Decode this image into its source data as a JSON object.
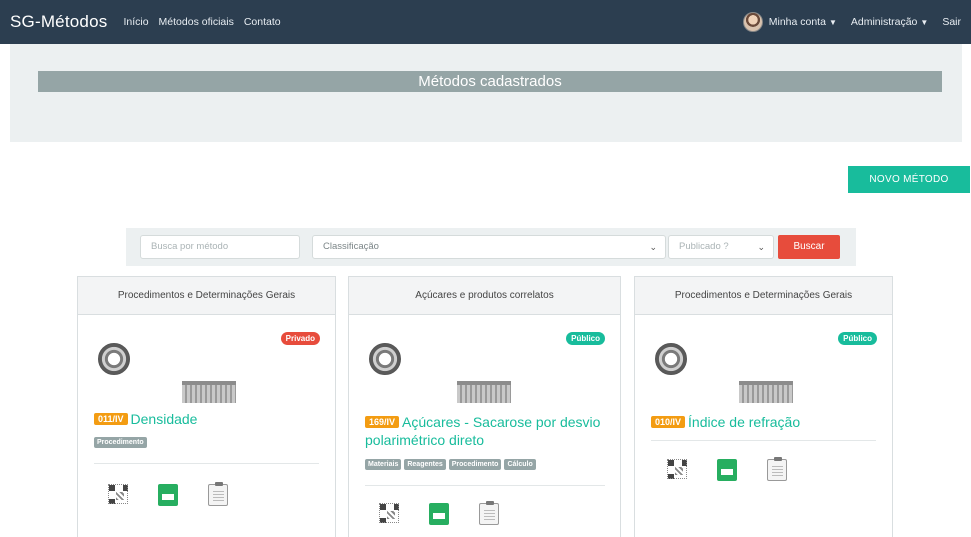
{
  "navbar": {
    "brand": "SG-Métodos",
    "links": [
      "Início",
      "Métodos oficiais",
      "Contato"
    ],
    "account": "Minha conta",
    "admin": "Administração",
    "logout": "Sair"
  },
  "jumbotron": {
    "title": "Métodos cadastrados"
  },
  "actions": {
    "new_method": "NOVO MÉTODO"
  },
  "filters": {
    "search_placeholder": "Busca por método",
    "classification": "Classificação",
    "published": "Publicado ?",
    "search_button": "Buscar"
  },
  "cards": [
    {
      "header": "Procedimentos e Determinações Gerais",
      "status": "Privado",
      "code": "011/IV",
      "title": "Densidade",
      "tags": [
        "Procedimento"
      ]
    },
    {
      "header": "Açúcares e produtos correlatos",
      "status": "Público",
      "code": "169/IV",
      "title": "Açúcares - Sacarose por desvio polarimétrico direto",
      "tags": [
        "Materiais",
        "Reagentes",
        "Procedimento",
        "Cálculo"
      ]
    },
    {
      "header": "Procedimentos e Determinações Gerais",
      "status": "Público",
      "code": "010/IV",
      "title": "Índice de refração",
      "tags": []
    }
  ],
  "colors": {
    "navbar": "#2c3e50",
    "success": "#18bc9c",
    "danger": "#e74c3c",
    "warning": "#f39c12",
    "muted": "#95a5a6"
  }
}
